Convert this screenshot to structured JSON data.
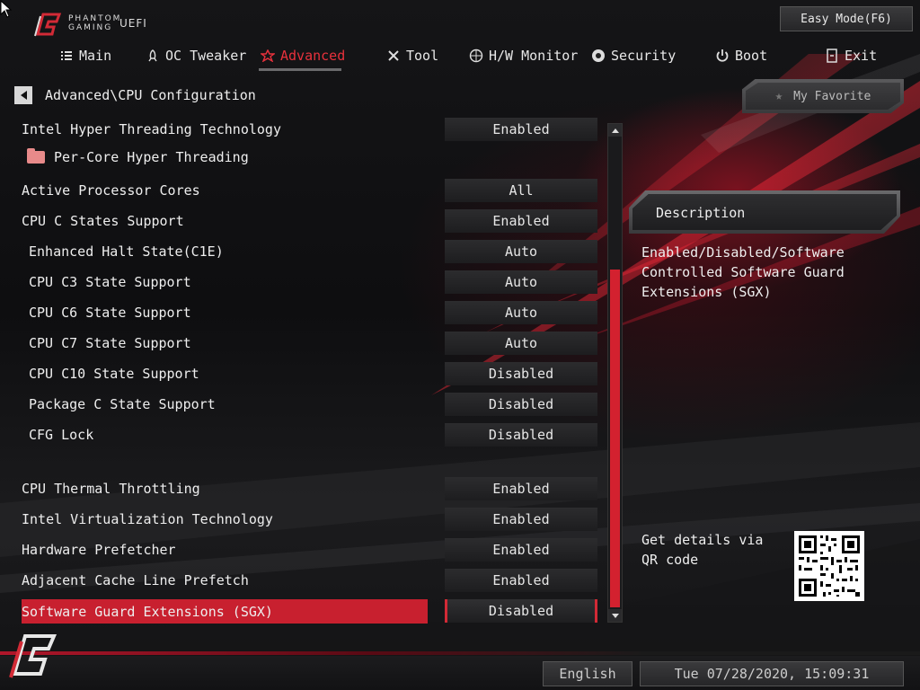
{
  "header": {
    "brand_line1": "PHANTOM",
    "brand_line2": "GAMING",
    "brand_uefi": "UEFI",
    "easy_mode_label": "Easy Mode(F6)"
  },
  "tabs": [
    {
      "label": "Main",
      "icon": "list-icon"
    },
    {
      "label": "OC Tweaker",
      "icon": "rocket-icon"
    },
    {
      "label": "Advanced",
      "icon": "star-icon",
      "active": true
    },
    {
      "label": "Tool",
      "icon": "tools-icon"
    },
    {
      "label": "H/W Monitor",
      "icon": "monitor-icon"
    },
    {
      "label": "Security",
      "icon": "shield-icon"
    },
    {
      "label": "Boot",
      "icon": "power-icon"
    },
    {
      "label": "Exit",
      "icon": "exit-icon"
    }
  ],
  "breadcrumb": "Advanced\\CPU Configuration",
  "favorite_label": "My Favorite",
  "settings": [
    {
      "label": "Intel Hyper Threading Technology",
      "value": "Enabled"
    },
    {
      "label": "Per-Core Hyper Threading",
      "value": null,
      "folder": true
    },
    {
      "label": "Active Processor Cores",
      "value": "All"
    },
    {
      "label": "CPU C States Support",
      "value": "Enabled"
    },
    {
      "label": "Enhanced Halt State(C1E)",
      "value": "Auto"
    },
    {
      "label": "CPU C3 State Support",
      "value": "Auto"
    },
    {
      "label": "CPU C6 State Support",
      "value": "Auto"
    },
    {
      "label": "CPU C7 State Support",
      "value": "Auto"
    },
    {
      "label": "CPU C10 State Support",
      "value": "Disabled"
    },
    {
      "label": "Package C State Support",
      "value": "Disabled"
    },
    {
      "label": "CFG Lock",
      "value": "Disabled"
    },
    {
      "label": "CPU Thermal Throttling",
      "value": "Enabled"
    },
    {
      "label": "Intel Virtualization Technology",
      "value": "Enabled"
    },
    {
      "label": "Hardware Prefetcher",
      "value": "Enabled"
    },
    {
      "label": "Adjacent Cache Line Prefetch",
      "value": "Enabled"
    },
    {
      "label": "Software Guard Extensions (SGX)",
      "value": "Disabled",
      "selected": true
    }
  ],
  "description": {
    "title": "Description",
    "text": "Enabled/Disabled/Software Controlled Software Guard Extensions (SGX)"
  },
  "qr_text": "Get details via QR code",
  "footer": {
    "language": "English",
    "datetime": "Tue 07/28/2020, 15:09:31"
  },
  "colors": {
    "accent": "#d3212f",
    "background": "#0c0c0d"
  }
}
